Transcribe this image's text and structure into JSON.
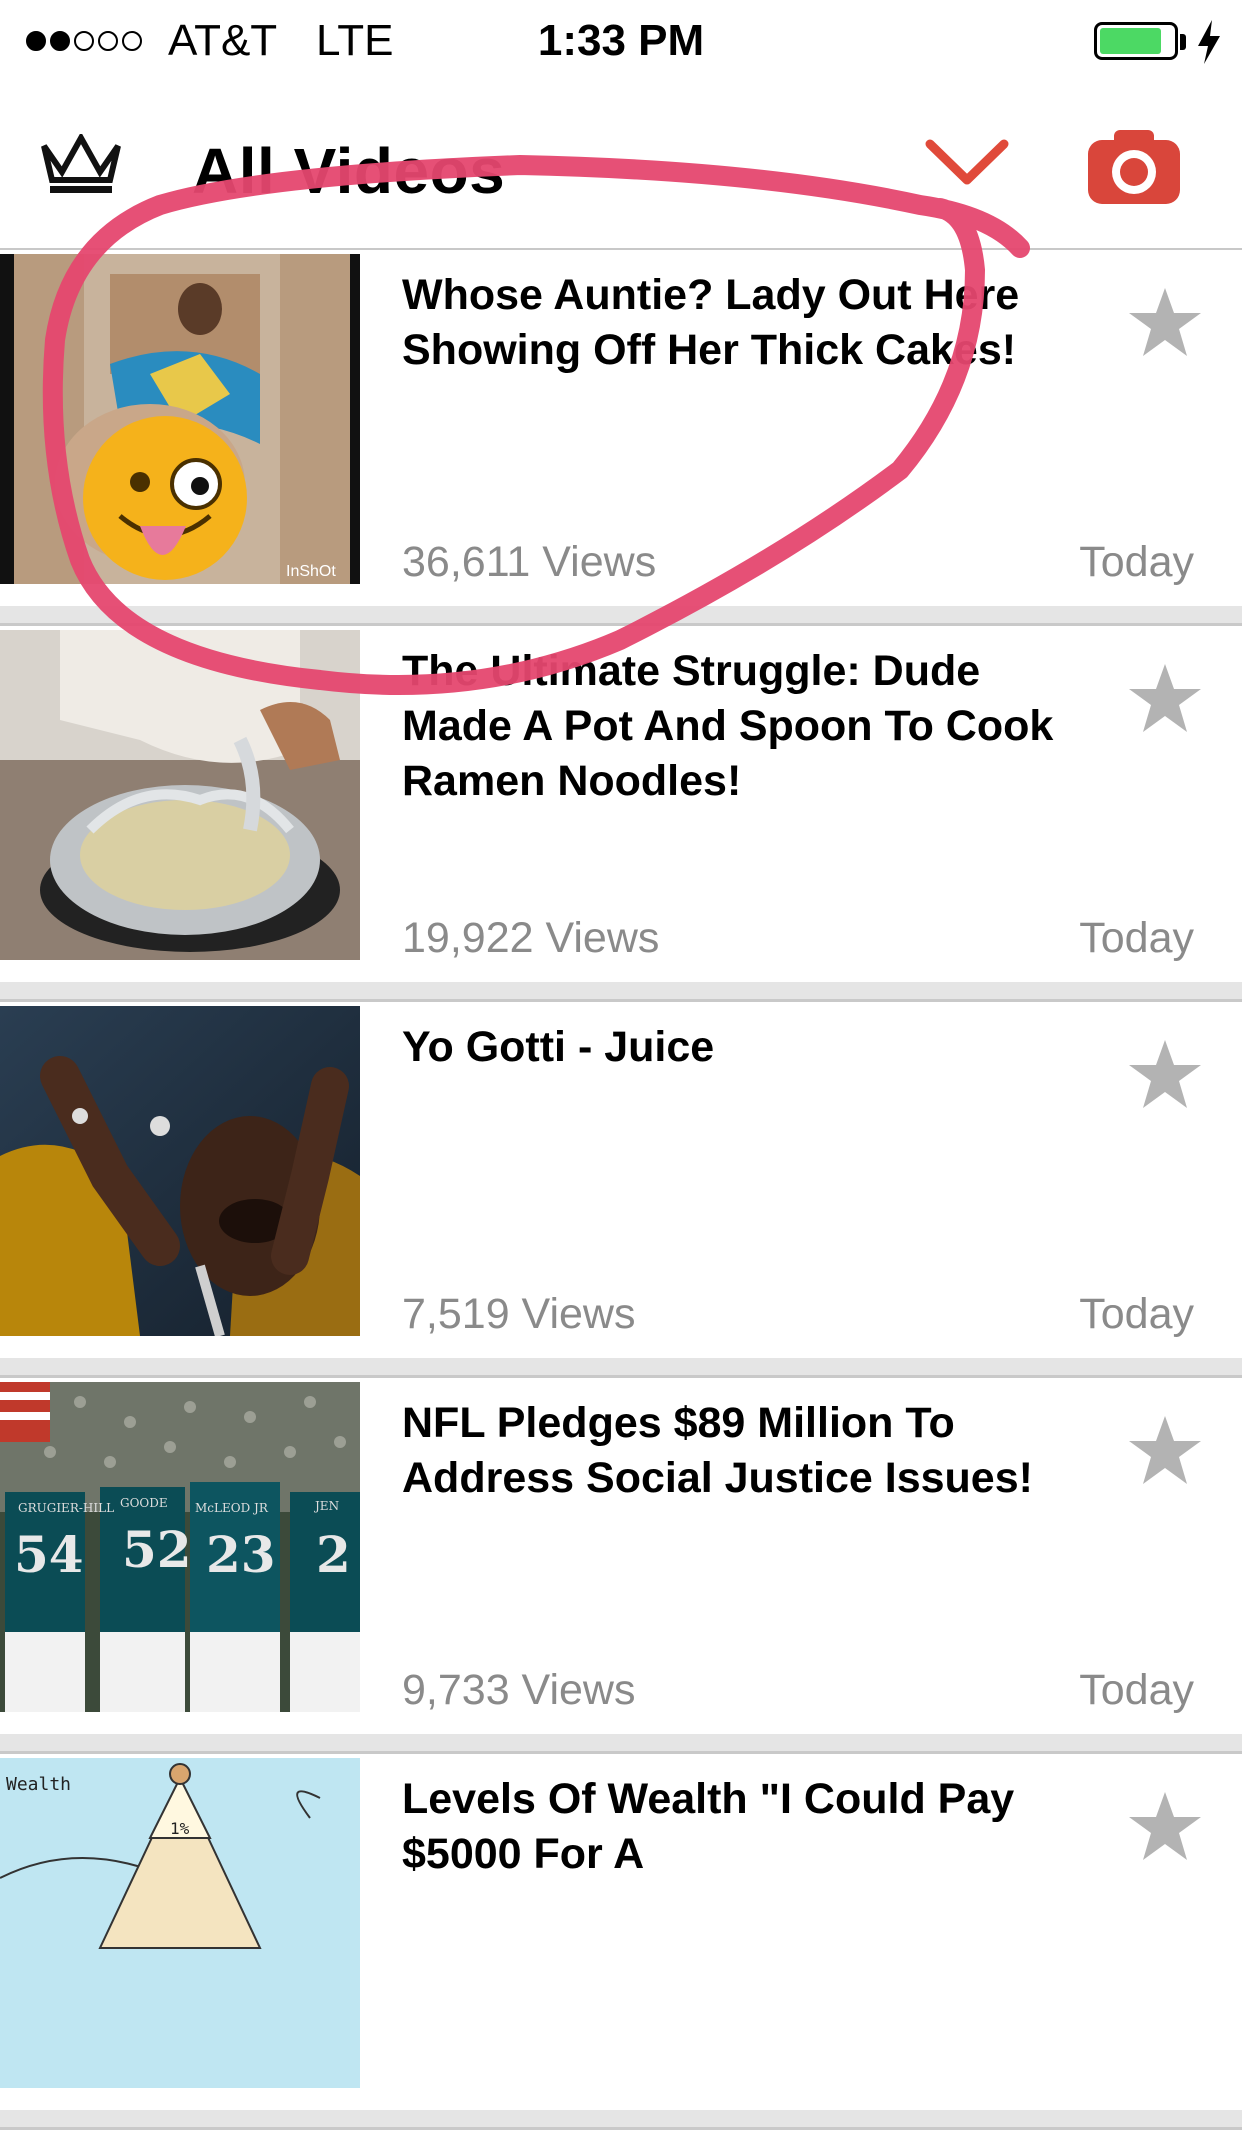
{
  "status_bar": {
    "signal_bars": 2,
    "carrier": "AT&T",
    "network": "LTE",
    "time": "1:33 PM",
    "battery_level": 0.85,
    "charging": true
  },
  "nav": {
    "title": "All Videos",
    "logo_icon": "crown-icon",
    "dropdown_icon": "chevron-down-icon",
    "camera_icon": "camera-icon",
    "accent_color": "#e04a3a"
  },
  "videos": [
    {
      "title": "Whose Auntie? Lady Out Here Showing Off Her Thick Cakes!",
      "views": "36,611 Views",
      "date": "Today",
      "thumbnail_watermark": "InShOt"
    },
    {
      "title": "The Ultimate Struggle: Dude Made A Pot And Spoon To Cook Ramen Noodles!",
      "views": "19,922 Views",
      "date": "Today"
    },
    {
      "title": "Yo Gotti - Juice",
      "views": "7,519 Views",
      "date": "Today"
    },
    {
      "title": "NFL Pledges $89 Million To Address Social Justice Issues!",
      "views": "9,733 Views",
      "date": "Today",
      "thumbnail_jersey_numbers": [
        "54",
        "52",
        "23",
        "2"
      ],
      "thumbnail_jersey_names": [
        "GRUGIER-HILL",
        "GOODE",
        "McLEOD JR",
        "JEN"
      ]
    },
    {
      "title": "Levels Of Wealth \"I Could Pay $5000 For A",
      "views": "",
      "date": "",
      "thumbnail_label": "Wealth",
      "thumbnail_percent": "1%"
    }
  ],
  "colors": {
    "annotation_stroke": "#e5476f",
    "meta_text": "#8a8a8a",
    "star": "#b3b3b3"
  }
}
